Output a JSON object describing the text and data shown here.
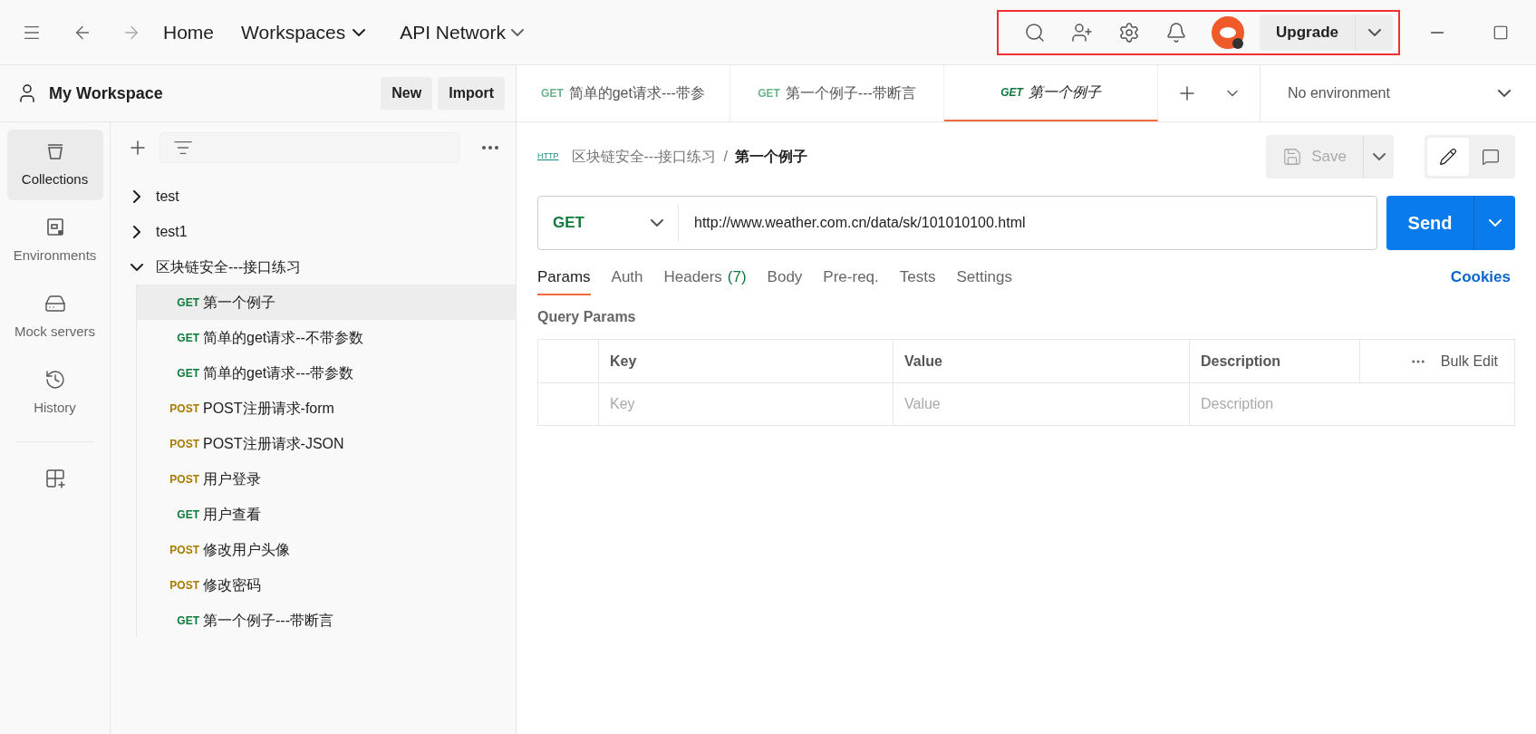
{
  "top_nav": {
    "home": "Home",
    "workspaces": "Workspaces",
    "api_network": "API Network",
    "upgrade": "Upgrade"
  },
  "workspace": {
    "title": "My Workspace",
    "new_button": "New",
    "import_button": "Import"
  },
  "sidebar": {
    "items": [
      {
        "kind": "collections",
        "label": "Collections",
        "selected": true
      },
      {
        "kind": "environments",
        "label": "Environments",
        "selected": false
      },
      {
        "kind": "mock",
        "label": "Mock servers",
        "selected": false
      },
      {
        "kind": "history",
        "label": "History",
        "selected": false
      }
    ]
  },
  "tree": [
    {
      "name": "test",
      "expanded": false
    },
    {
      "name": "test1",
      "expanded": false
    },
    {
      "name": "区块链安全---接口练习",
      "expanded": true,
      "children": [
        {
          "kind": "get",
          "method": "GET",
          "name": "第一个例子",
          "selected": true
        },
        {
          "kind": "get",
          "method": "GET",
          "name": "简单的get请求--不带参数",
          "selected": false
        },
        {
          "kind": "get",
          "method": "GET",
          "name": "简单的get请求---带参数",
          "selected": false
        },
        {
          "kind": "post",
          "method": "POST",
          "name": "POST注册请求-form",
          "selected": false
        },
        {
          "kind": "post",
          "method": "POST",
          "name": "POST注册请求-JSON",
          "selected": false
        },
        {
          "kind": "post",
          "method": "POST",
          "name": "用户登录",
          "selected": false
        },
        {
          "kind": "get",
          "method": "GET",
          "name": "用户查看",
          "selected": false
        },
        {
          "kind": "post",
          "method": "POST",
          "name": "修改用户头像",
          "selected": false
        },
        {
          "kind": "post",
          "method": "POST",
          "name": "修改密码",
          "selected": false
        },
        {
          "kind": "get",
          "method": "GET",
          "name": "第一个例子---带断言",
          "selected": false
        }
      ]
    }
  ],
  "request_tabs": [
    {
      "method": "GET",
      "title": "简单的get请求---带参",
      "selected": false,
      "preview": false
    },
    {
      "method": "GET",
      "title": "第一个例子---带断言",
      "selected": false,
      "preview": false
    },
    {
      "method": "GET",
      "title": "第一个例子",
      "selected": true,
      "preview": true
    }
  ],
  "environment": "No environment",
  "breadcrumb": {
    "icon_label": "HTTP",
    "collection": "区块链安全---接口练习",
    "separator": "/",
    "request": "第一个例子"
  },
  "save_button": "Save",
  "request": {
    "method": "GET",
    "url": "http://www.weather.com.cn/data/sk/101010100.html",
    "send": "Send"
  },
  "option_tabs": [
    {
      "label": "Params",
      "selected": true
    },
    {
      "label": "Auth",
      "selected": false
    },
    {
      "label": "Headers",
      "count": "(7)",
      "selected": false
    },
    {
      "label": "Body",
      "selected": false
    },
    {
      "label": "Pre-req.",
      "selected": false
    },
    {
      "label": "Tests",
      "selected": false
    },
    {
      "label": "Settings",
      "selected": false
    }
  ],
  "cookies": "Cookies",
  "query_params": {
    "title": "Query Params",
    "columns": [
      "Key",
      "Value",
      "Description"
    ],
    "bulk_edit": "Bulk Edit",
    "placeholders": [
      "Key",
      "Value",
      "Description"
    ]
  }
}
